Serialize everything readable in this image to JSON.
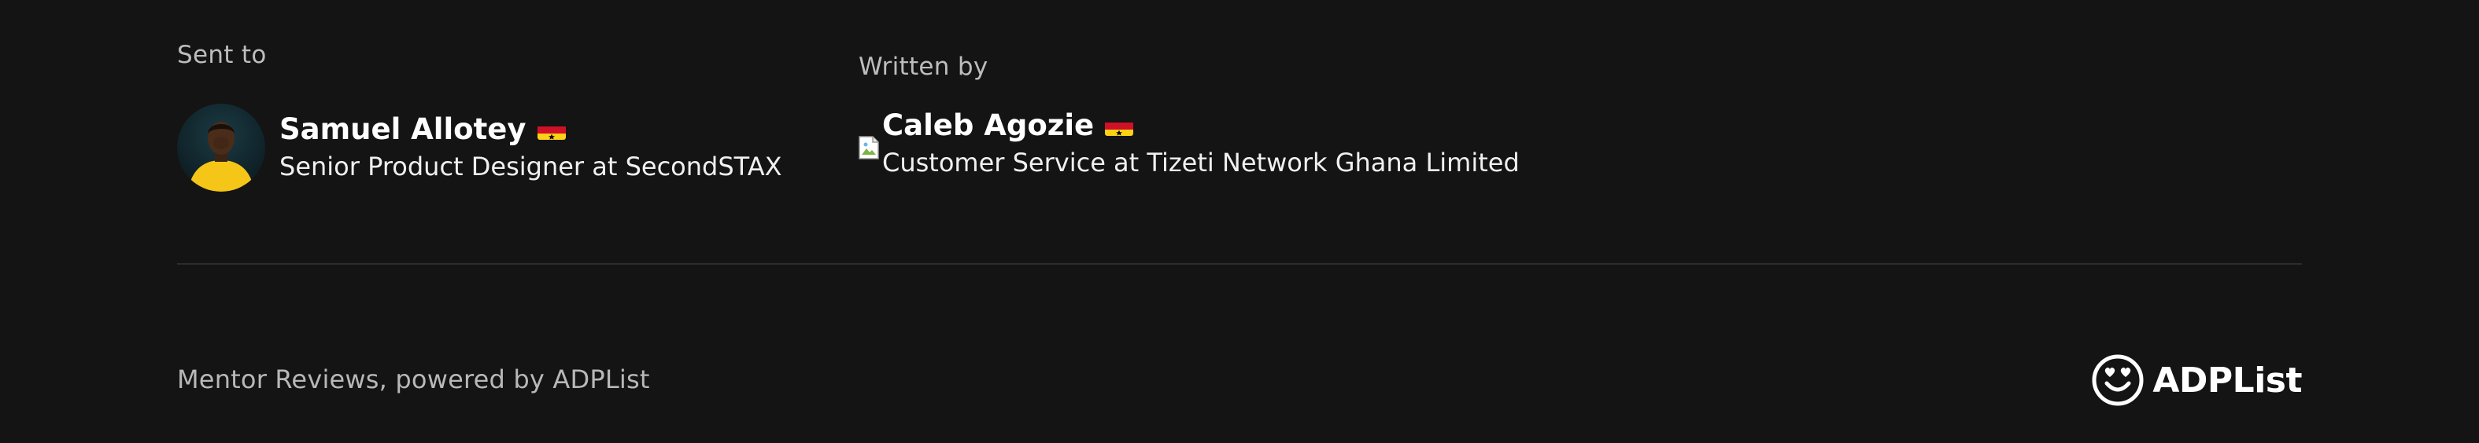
{
  "recipient": {
    "heading": "Sent to",
    "name": "Samuel Allotey",
    "flag_icon": "ghana-flag-icon",
    "role": "Senior Product Designer at SecondSTAX"
  },
  "author": {
    "heading": "Written by",
    "name": "Caleb Agozie",
    "flag_icon": "ghana-flag-icon",
    "role": "Customer Service at Tizeti Network Ghana Limited"
  },
  "footer": {
    "powered_by": "Mentor Reviews, powered by ADPList",
    "brand_icon": "smiley-heart-eyes-icon",
    "brand_name": "ADPList"
  },
  "colors": {
    "background": "#141414",
    "text_primary": "#ffffff",
    "text_secondary": "#bdbdbd",
    "divider": "#2c2c2c",
    "avatar_shirt": "#f5c518"
  }
}
